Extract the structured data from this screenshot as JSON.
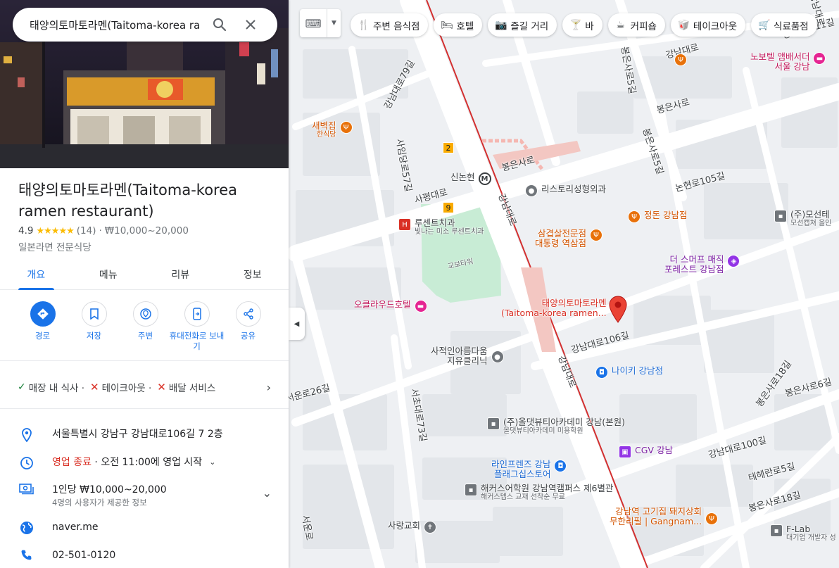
{
  "search": {
    "query": "태양의토마토라멘(Taitoma-korea ra"
  },
  "place": {
    "title": "태양의토마토라멘(Taitoma-korea ramen restaurant)",
    "rating": "4.9",
    "stars": "★★★★★",
    "review_count": "(14)",
    "separator": "·",
    "price": "₩10,000~20,000",
    "category": "일본라면 전문식당"
  },
  "tabs": [
    {
      "label": "개요"
    },
    {
      "label": "메뉴"
    },
    {
      "label": "리뷰"
    },
    {
      "label": "정보"
    }
  ],
  "actions": [
    {
      "label": "경로",
      "icon": "directions-icon"
    },
    {
      "label": "저장",
      "icon": "bookmark-icon"
    },
    {
      "label": "주변",
      "icon": "nearby-icon"
    },
    {
      "label": "휴대전화로 보내기",
      "icon": "send-to-phone-icon"
    },
    {
      "label": "공유",
      "icon": "share-icon"
    }
  ],
  "services": {
    "dine_in": "매장 내 식사 ·",
    "takeout": "테이크아웃 ·",
    "delivery": "배달 서비스"
  },
  "info": {
    "address": "서울특별시 강남구 강남대로106길 7 2층",
    "hours_status": "영업 종료",
    "hours_detail": " · 오전 11:00에 영업 시작",
    "price_per_person": "1인당 ₩10,000~20,000",
    "price_note": "4명의 사용자가 제공한 정보",
    "website": "naver.me",
    "phone": "02-501-0120"
  },
  "chips": [
    {
      "label": "주변 음식점",
      "icon": "utensils-icon"
    },
    {
      "label": "호텔",
      "icon": "bed-icon"
    },
    {
      "label": "즐길 거리",
      "icon": "camera-icon"
    },
    {
      "label": "바",
      "icon": "cocktail-icon"
    },
    {
      "label": "커피숍",
      "icon": "coffee-icon"
    },
    {
      "label": "테이크아웃",
      "icon": "takeout-icon"
    },
    {
      "label": "식료품점",
      "icon": "cart-icon"
    }
  ],
  "map": {
    "roads": {
      "gangnamdaero79": "강남대로79길",
      "saimdang57": "사임당로57길",
      "bongeun5": "봉은사로5길",
      "bongeunsaro": "봉은사로",
      "bongeunsaro_a": "봉은사로",
      "bongeun5b": "봉은사로5길",
      "nonhyeon105": "논현로105길",
      "sapyeongdaero": "사평대로",
      "gangnamdae_v": "강남대로",
      "gangnam_top": "강남대로",
      "gangnam106": "강남대로106길",
      "gangnam_v2": "강남대로",
      "seocho73": "서초대로73길",
      "seoun26": "서운로26길",
      "bongeun18": "봉은사로18길",
      "bongeun6": "봉은사로6길",
      "gangnam100": "강남대로100길",
      "teheran5": "테헤란로5길",
      "bongeun18b": "봉은사로18길",
      "seoullo": "서운로",
      "gangnam11": "강남대로11길",
      "gangnamdaero_top2": "강남대로"
    },
    "pois": {
      "novotel": "노보텔 앰배서더",
      "novotel2": "서울 강남",
      "saebyeok": "새벽집",
      "saebyeok_sub": "한식당",
      "sinnonhyeon": "신논현",
      "history": "리스토리성형외과",
      "jeongdon": "정돈 강남점",
      "mosen": "(주)모선테",
      "mosen_sub": "모선캡쳐 을인",
      "lucent": "루센트치과",
      "lucent_sub": "빛나는 미소 루센트치과",
      "samgyeop1": "삼겹살전문점",
      "samgyeop2": "대통령 역삼점",
      "smooth1": "더 스머프 매직",
      "smooth2": "포레스트 강남점",
      "kyobo": "교보타워",
      "cloud": "오클라우드호텔",
      "target1": "태양의토마토라멘",
      "target2": "(Taitoma-korea ramen...",
      "sajeok1": "사적인아름다움",
      "sajeok2": "지유클리닉",
      "nike": "나이키 강남점",
      "allbeauty": "(주)올댓뷰티아카데미 강남(본원)",
      "allbeauty_sub": "올댓뷰티아카데미 미용학원",
      "cgv": "CGV 강남",
      "line1": "라인프렌즈 강남",
      "line2": "플래그십스토어",
      "hackers": "해커스어학원 강남역캠퍼스 제6별관",
      "hackers_sub": "해커스텝스 교재 선착순 무료",
      "sarang": "사랑교회",
      "gogi1": "강남역 고기집 돼지상회",
      "gogi2": "무한리필 | Gangnam...",
      "flab": "F-Lab",
      "flab_sub": "대기업 개발자 성",
      "badge2": "2",
      "badge9": "9"
    }
  },
  "colors": {
    "accent": "#1a73e8",
    "marker": "#ea4335",
    "closed": "#d93025",
    "star": "#fbbc04"
  }
}
